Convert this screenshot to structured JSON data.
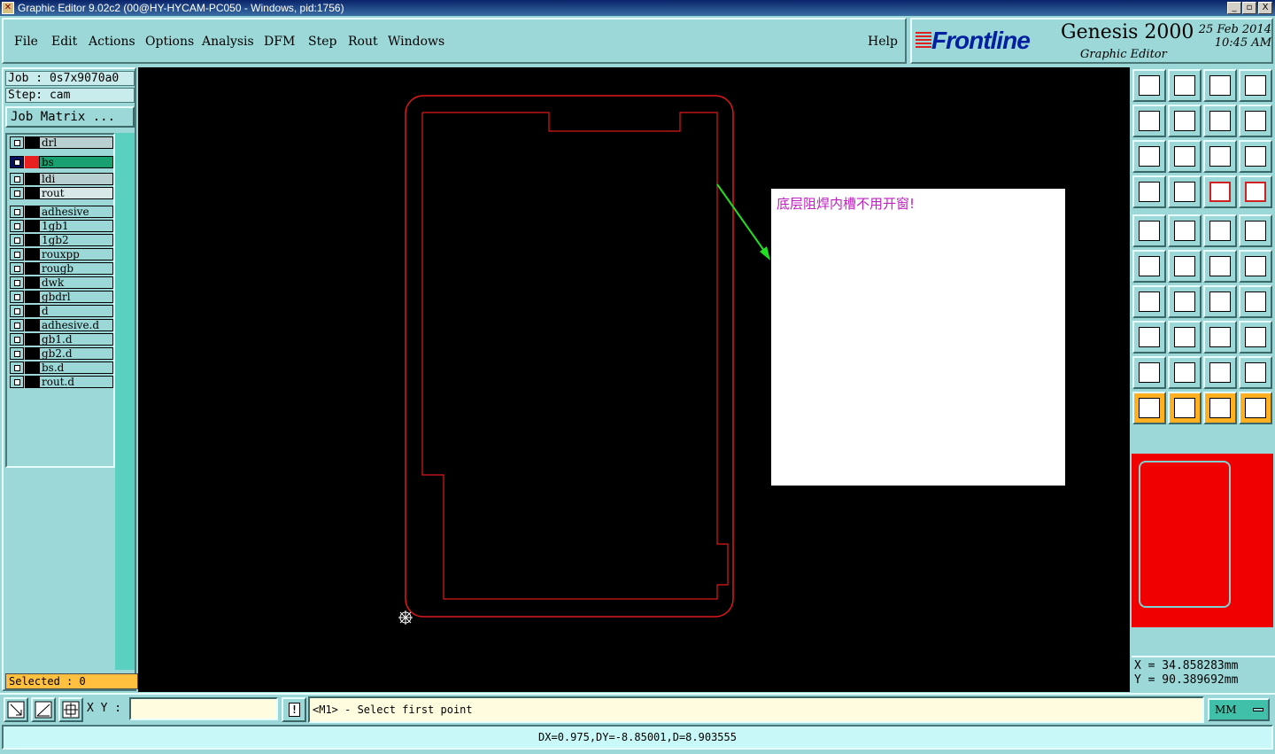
{
  "window": {
    "title": "Graphic Editor 9.02c2 (00@HY-HYCAM-PC050 - Windows, pid:1756)",
    "controls": [
      "_",
      "▫",
      "X"
    ]
  },
  "menubar": {
    "items": [
      {
        "label": "File"
      },
      {
        "label": "Edit"
      },
      {
        "label": "Actions"
      },
      {
        "label": "Options"
      },
      {
        "label": "Analysis"
      },
      {
        "label": "DFM"
      },
      {
        "label": "Step"
      },
      {
        "label": "Rout"
      },
      {
        "label": "Windows"
      }
    ],
    "help": "Help"
  },
  "logo": {
    "brand": "Frontline",
    "product": "Genesis 2000",
    "subtitle": "Graphic Editor",
    "date": "25 Feb 2014",
    "time": "10:45 AM"
  },
  "leftpanel": {
    "job": "Job : 0s7x9070a0",
    "step": "Step: cam",
    "job_matrix": "Job Matrix ...",
    "layers": [
      {
        "name": "drl",
        "kind": "board"
      },
      {
        "name": "bs",
        "kind": "active"
      },
      {
        "name": "ldi",
        "kind": "board"
      },
      {
        "name": "rout",
        "kind": "board-light"
      },
      {
        "name": "adhesive",
        "kind": "misc"
      },
      {
        "name": "1gb1",
        "kind": "misc"
      },
      {
        "name": "1gb2",
        "kind": "misc"
      },
      {
        "name": "rouxpp",
        "kind": "misc"
      },
      {
        "name": "rougb",
        "kind": "misc"
      },
      {
        "name": "dwk",
        "kind": "misc"
      },
      {
        "name": "gbdrl",
        "kind": "misc"
      },
      {
        "name": "d",
        "kind": "misc"
      },
      {
        "name": "adhesive.d",
        "kind": "misc"
      },
      {
        "name": "gb1.d",
        "kind": "misc"
      },
      {
        "name": "gb2.d",
        "kind": "misc"
      },
      {
        "name": "bs.d",
        "kind": "misc"
      },
      {
        "name": "rout.d",
        "kind": "misc"
      }
    ],
    "selected": "Selected : 0"
  },
  "canvas": {
    "note": "底层阻焊内槽不用开窗!",
    "outline_color": "#e01818",
    "arrow_color": "#20e020"
  },
  "coords": {
    "x": "X = 34.858283mm",
    "y": "Y = 90.389692mm"
  },
  "bottom": {
    "xy_label": "X Y :",
    "xy_value": "",
    "warn_label": "!",
    "prompt": "<M1> - Select first point",
    "units": "MM",
    "status": "DX=0.975,DY=-8.85001,D=8.903555"
  }
}
